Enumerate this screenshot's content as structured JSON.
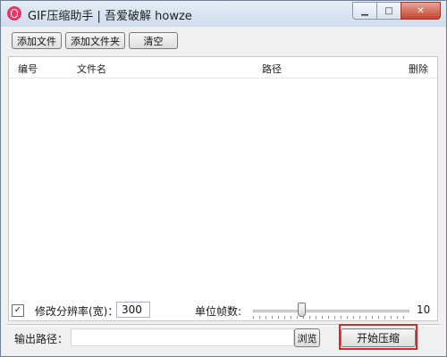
{
  "window": {
    "title": "GIF压缩助手 | 吾爱破解 howze",
    "minimize_glyph": "▁",
    "maximize_glyph": "□",
    "close_glyph": "✕"
  },
  "toolbar": {
    "add_file_label": "添加文件",
    "add_folder_label": "添加文件夹",
    "clear_label": "清空"
  },
  "list": {
    "columns": {
      "id": "编号",
      "filename": "文件名",
      "path": "路径",
      "delete": "删除"
    },
    "rows": []
  },
  "options": {
    "resize_checked": true,
    "resize_label": "修改分辨率(宽)：",
    "width_value": "300",
    "fps_label": "单位帧数:",
    "fps_slider_fraction": 0.3,
    "fps_value": "10"
  },
  "output": {
    "label": "输出路径：",
    "path_value": "",
    "browse_label": "浏览",
    "start_label": "开始压缩"
  },
  "colors": {
    "highlight_box": "#d42a24",
    "app_icon": "#e03b6a"
  }
}
